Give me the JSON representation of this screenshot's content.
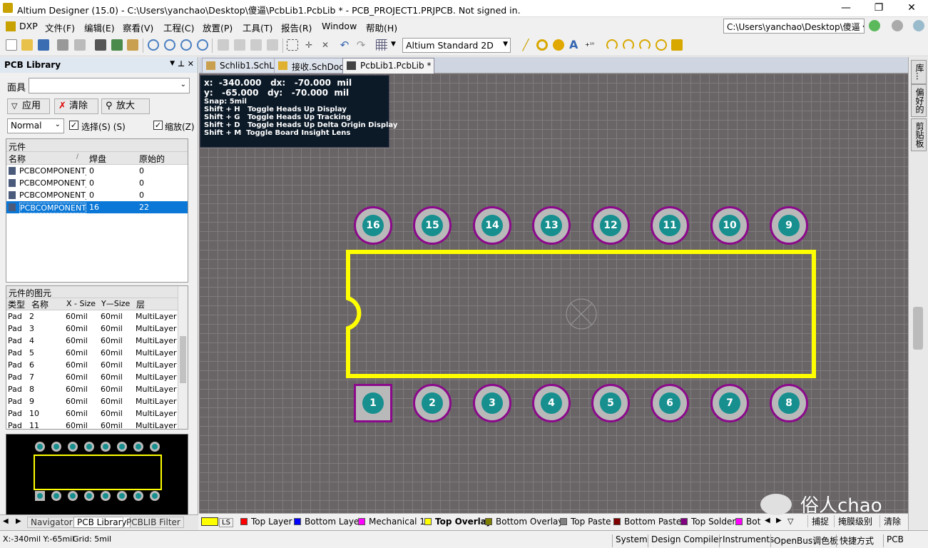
{
  "window": {
    "title": "Altium Designer (15.0) - C:\\Users\\yanchao\\Desktop\\傻逼\\PcbLib1.PcbLib * - PCB_PROJECT1.PRJPCB. Not signed in."
  },
  "menu": [
    "DXP",
    "文件(F)",
    "编辑(E)",
    "察看(V)",
    "工程(C)",
    "放置(P)",
    "工具(T)",
    "报告(R)",
    "Window",
    "帮助(H)"
  ],
  "path_box": "C:\\Users\\yanchao\\Desktop\\傻逼 ▾",
  "toolbar": {
    "view_mode": "Altium Standard 2D"
  },
  "panel": {
    "title": "PCB Library",
    "mask_label": "面具",
    "mask_value": "",
    "apply": "应用",
    "clear": "清除",
    "zoom": "放大",
    "filter_mode": "Normal",
    "select_label": "选择(S) (S)",
    "zoom_check": "缩放(Z)",
    "components_title": "元件",
    "comp_headers": [
      "名称",
      "焊盘",
      "原始的"
    ],
    "components": [
      {
        "name": "PCBCOMPONENT_",
        "pads": "0",
        "primitives": "0"
      },
      {
        "name": "PCBCOMPONENT_",
        "pads": "0",
        "primitives": "0"
      },
      {
        "name": "PCBCOMPONENT_",
        "pads": "0",
        "primitives": "0"
      },
      {
        "name": "PCBCOMPONENT_",
        "pads": "16",
        "primitives": "22"
      }
    ],
    "prims_title": "元件的图元",
    "prim_headers": [
      "类型",
      "名称",
      "X - Size",
      "Y—Size",
      "层"
    ],
    "primitives": [
      {
        "type": "Pad",
        "name": "2",
        "x": "60mil",
        "y": "60mil",
        "layer": "MultiLayer"
      },
      {
        "type": "Pad",
        "name": "3",
        "x": "60mil",
        "y": "60mil",
        "layer": "MultiLayer"
      },
      {
        "type": "Pad",
        "name": "4",
        "x": "60mil",
        "y": "60mil",
        "layer": "MultiLayer"
      },
      {
        "type": "Pad",
        "name": "5",
        "x": "60mil",
        "y": "60mil",
        "layer": "MultiLayer"
      },
      {
        "type": "Pad",
        "name": "6",
        "x": "60mil",
        "y": "60mil",
        "layer": "MultiLayer"
      },
      {
        "type": "Pad",
        "name": "7",
        "x": "60mil",
        "y": "60mil",
        "layer": "MultiLayer"
      },
      {
        "type": "Pad",
        "name": "8",
        "x": "60mil",
        "y": "60mil",
        "layer": "MultiLayer"
      },
      {
        "type": "Pad",
        "name": "9",
        "x": "60mil",
        "y": "60mil",
        "layer": "MultiLayer"
      },
      {
        "type": "Pad",
        "name": "10",
        "x": "60mil",
        "y": "60mil",
        "layer": "MultiLayer"
      },
      {
        "type": "Pad",
        "name": "11",
        "x": "60mil",
        "y": "60mil",
        "layer": "MultiLayer"
      }
    ],
    "bottom_tabs": [
      "Navigator",
      "PCB Library",
      "PCBLIB Filter"
    ]
  },
  "doc_tabs": [
    "Schlib1.SchLib",
    "接收.SchDoc",
    "PcbLib1.PcbLib *"
  ],
  "hud": {
    "line1": "x:  -340.000   dx:   -70.000  mil",
    "line2": "y:   -65.000   dy:   -70.000  mil",
    "snap": "Snap: 5mil",
    "hints": [
      "Shift + H   Toggle Heads Up Display",
      "Shift + G   Toggle Heads Up Tracking",
      "Shift + D   Toggle Heads Up Delta Origin Display",
      "Shift + M  Toggle Board Insight Lens"
    ]
  },
  "pads_top": [
    "16",
    "15",
    "14",
    "13",
    "12",
    "11",
    "10",
    "9"
  ],
  "pads_bottom": [
    "1",
    "2",
    "3",
    "4",
    "5",
    "6",
    "7",
    "8"
  ],
  "right_labels": [
    "库...",
    "偏好的",
    "剪贴板"
  ],
  "layers": [
    {
      "name": "LS",
      "color": "#ffff00"
    },
    {
      "name": "Top Layer",
      "color": "#ff0000"
    },
    {
      "name": "Bottom Layer",
      "color": "#0000ff"
    },
    {
      "name": "Mechanical 1",
      "color": "#ff00ff"
    },
    {
      "name": "Top Overlay",
      "color": "#ffff00"
    },
    {
      "name": "Bottom Overlay",
      "color": "#808000"
    },
    {
      "name": "Top Paste",
      "color": "#808080"
    },
    {
      "name": "Bottom Paste",
      "color": "#800000"
    },
    {
      "name": "Top Solder",
      "color": "#800080"
    },
    {
      "name": "Bot",
      "color": "#ff00ff"
    }
  ],
  "layer_actions": [
    "捕捉",
    "掩膜级别",
    "清除"
  ],
  "watermark": "俗人chao",
  "status": {
    "coords": "X:-340mil Y:-65mil",
    "grid": "Grid: 5mil",
    "buttons": [
      "System",
      "Design Compiler",
      "Instruments",
      "OpenBus调色板",
      "快捷方式",
      "PCB"
    ]
  }
}
